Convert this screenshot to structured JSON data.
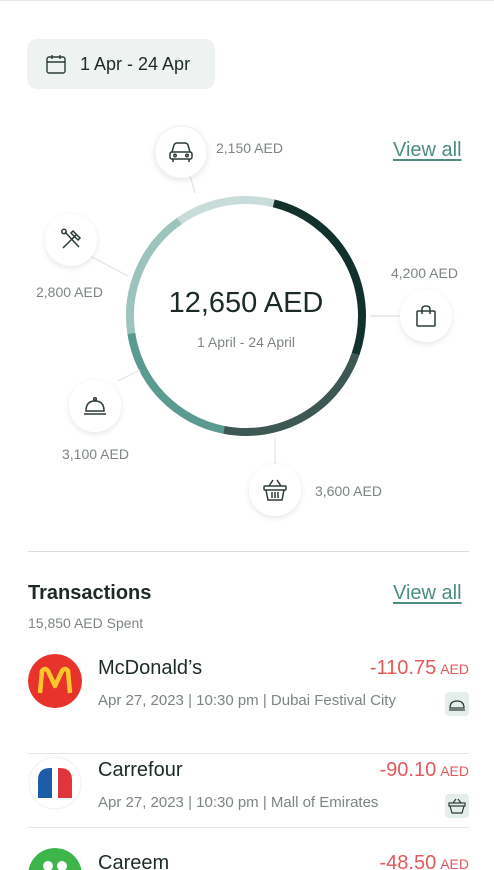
{
  "date_range": {
    "label": "1 Apr - 24 Apr"
  },
  "spending": {
    "total": "12,650 AED",
    "period": "1 April - 24 April",
    "view_all": "View all",
    "categories": [
      {
        "icon": "car-icon",
        "amount": "2,150 AED",
        "value": 2150,
        "color": "#c8ddd9"
      },
      {
        "icon": "shopping-bag-icon",
        "amount": "4,200 AED",
        "value": 4200,
        "color": "#13312c"
      },
      {
        "icon": "basket-icon",
        "amount": "3,600 AED",
        "value": 3600,
        "color": "#3d5753"
      },
      {
        "icon": "food-cloche-icon",
        "amount": "3,100 AED",
        "value": 3100,
        "color": "#5a9a90"
      },
      {
        "icon": "tools-icon",
        "amount": "2,800 AED",
        "value": 2800,
        "color": "#9cc3bc"
      }
    ]
  },
  "transactions": {
    "title": "Transactions",
    "spent": "15,850 AED Spent",
    "view_all": "View all",
    "items": [
      {
        "name": "McDonald’s",
        "meta": "Apr 27, 2023 | 10:30 pm | Dubai Festival City",
        "amount": "-110.75",
        "currency": "AED",
        "logo": "mcdonalds-logo",
        "category_icon": "food-cloche-icon"
      },
      {
        "name": "Carrefour",
        "meta": "Apr 27, 2023 | 10:30 pm | Mall of Emirates",
        "amount": "-90.10",
        "currency": "AED",
        "logo": "carrefour-logo",
        "category_icon": "basket-icon"
      },
      {
        "name": "Careem",
        "meta": "",
        "amount": "-48.50",
        "currency": "AED",
        "logo": "careem-logo",
        "category_icon": "car-icon"
      }
    ]
  }
}
